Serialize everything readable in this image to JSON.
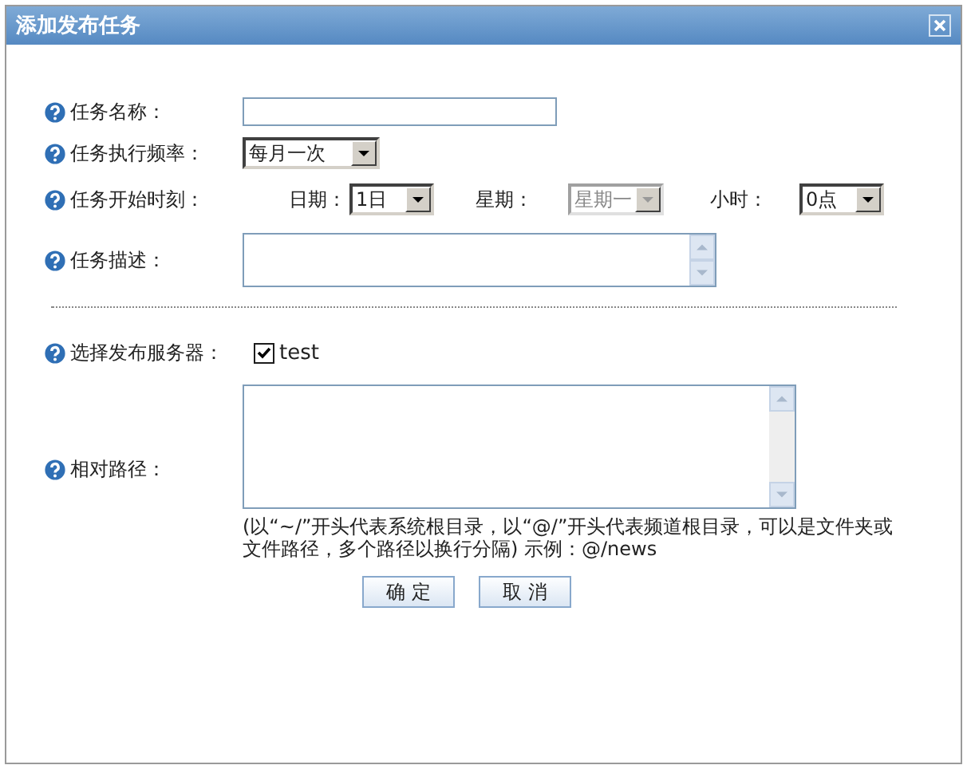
{
  "window": {
    "title": "添加发布任务"
  },
  "task_fields": [
    {
      "kind": "text",
      "label": "任务名称："
    },
    {
      "kind": "select",
      "label": "任务执行频率：",
      "value": "每月一次"
    },
    {
      "kind": "schedule",
      "label": "任务开始时刻：",
      "parts": [
        {
          "label": "日期：",
          "value": "1日",
          "disabled": false
        },
        {
          "label": "星期：",
          "value": "星期一",
          "disabled": true
        },
        {
          "label": "小时：",
          "value": "0点",
          "disabled": false
        }
      ]
    },
    {
      "kind": "textarea",
      "label": "任务描述："
    }
  ],
  "publish_fields": [
    {
      "kind": "checkboxes",
      "label": "选择发布服务器：",
      "options": [
        {
          "label": "test",
          "checked": true
        }
      ]
    },
    {
      "kind": "textarea",
      "label": "相对路径：",
      "hint": "(以“~/”开头代表系统根目录，以“@/”开头代表频道根目录，可以是文件夹或文件路径，多个路径以换行分隔) 示例：@/news"
    }
  ],
  "buttons": [
    {
      "label": "确 定"
    },
    {
      "label": "取 消"
    }
  ]
}
